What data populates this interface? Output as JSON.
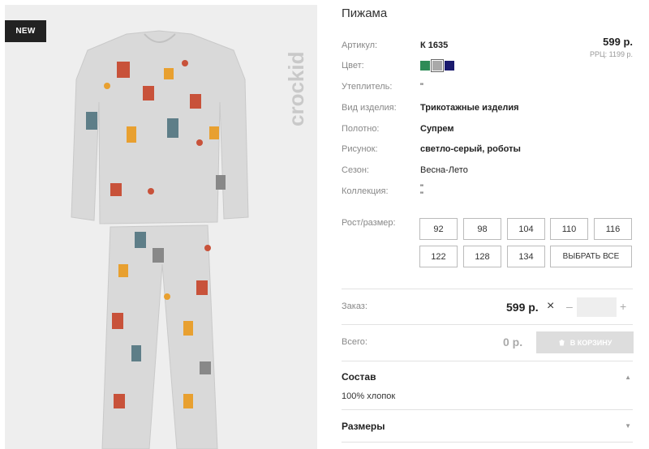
{
  "badge": {
    "label": "NEW"
  },
  "brand": {
    "name": "crockid"
  },
  "product": {
    "title": "Пижама",
    "price": "599 р.",
    "rrp": "РРЦ: 1199 р."
  },
  "details": [
    {
      "label": "Артикул:",
      "value": "К 1635",
      "bold": true
    },
    {
      "label": "Цвет:",
      "value": ""
    },
    {
      "label": "Утеплитель:",
      "value": "\"",
      "bold": false
    },
    {
      "label": "Вид изделия:",
      "value": "Трикотажные изделия",
      "bold": true
    },
    {
      "label": "Полотно:",
      "value": "Супрем",
      "bold": true
    },
    {
      "label": "Рисунок:",
      "value": "светло-серый, роботы",
      "bold": true
    },
    {
      "label": "Сезон:",
      "value": "Весна-Лето",
      "bold": false
    },
    {
      "label": "Коллекция:",
      "value": "\"\n\"",
      "bold": false
    }
  ],
  "colors": [
    {
      "name": "green",
      "hex": "#2e8b57",
      "selected": false
    },
    {
      "name": "grey",
      "hex": "#a9a9a9",
      "selected": true
    },
    {
      "name": "navy",
      "hex": "#1b1b6e",
      "selected": false
    }
  ],
  "sizes": {
    "label": "Рост/размер:",
    "options": [
      "92",
      "98",
      "104",
      "110",
      "116",
      "122",
      "128",
      "134"
    ],
    "select_all": "ВЫБРАТЬ ВСЕ"
  },
  "order": {
    "label": "Заказ:",
    "price": "599 р.",
    "times": "×",
    "minus": "–",
    "plus": "+",
    "quantity": ""
  },
  "total": {
    "label": "Всего:",
    "value": "0 р.",
    "cart_button": "В КОРЗИНУ"
  },
  "composition": {
    "title": "Состав",
    "text": "100% хлопок"
  },
  "size_chart": {
    "title": "Размеры"
  }
}
